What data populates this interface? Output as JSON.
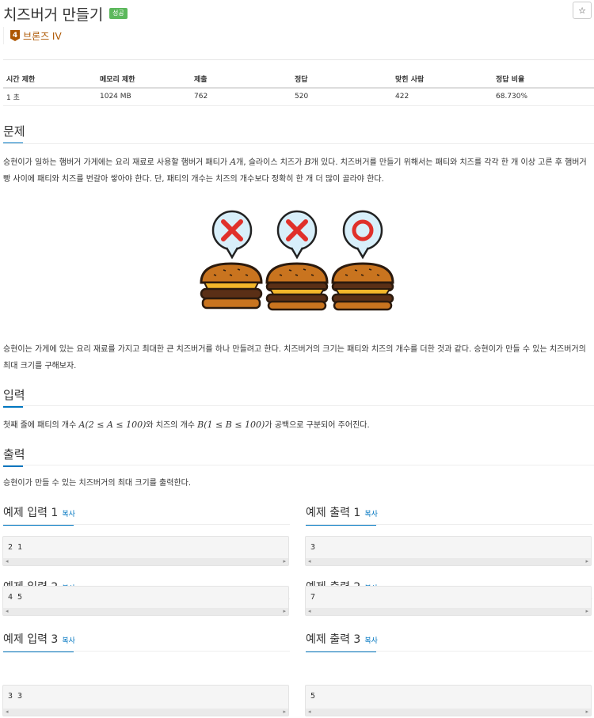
{
  "problem": {
    "title": "치즈버거 만들기",
    "result_badge": "성공",
    "star_icon": "☆",
    "tier": {
      "number": "4",
      "label": "브론즈 IV"
    }
  },
  "info_table": {
    "headers": [
      "시간 제한",
      "메모리 제한",
      "제출",
      "정답",
      "맞힌 사람",
      "정답 비율"
    ],
    "values": [
      "1 초",
      "1024 MB",
      "762",
      "520",
      "422",
      "68.730%"
    ]
  },
  "sections": {
    "problem_title": "문제",
    "problem_text_1a": "승현이가 일하는 햄버거 가게에는 요리 재료로 사용할 햄버거 패티가 ",
    "var_a": "A",
    "problem_text_1b": "개, 슬라이스 치즈가 ",
    "var_b": "B",
    "problem_text_1c": "개 있다. 치즈버거를 만들기 위해서는 패티와 치즈를 각각 한 개 이상 고른 후 햄버거 빵 사이에 패티와 치즈를 번갈아 쌓아야 한다. 단, 패티의 개수는 치즈의 개수보다 정확히 한 개 더 많이 골라야 한다.",
    "problem_text_2": "승현이는 가게에 있는 요리 재료를 가지고 최대한 큰 치즈버거를 하나 만들려고 한다. 치즈버거의 크기는 패티와 치즈의 개수를 더한 것과 같다. 승현이가 만들 수 있는 치즈버거의 최대 크기를 구해보자.",
    "input_title": "입력",
    "input_text_a": "첫째 줄에 패티의 개수 ",
    "input_math_a": "A(2 ≤ A ≤ 100)",
    "input_text_b": "와 치즈의 개수 ",
    "input_math_b": "B(1 ≤ B ≤ 100)",
    "input_text_c": "가 공백으로 구분되어 주어진다.",
    "output_title": "출력",
    "output_text": "승현이가 만들 수 있는 치즈버거의 최대 크기를 출력한다."
  },
  "examples": {
    "copy_label": "복사",
    "items": [
      {
        "in_title": "예제 입력 1",
        "in_value": "2 1",
        "out_title": "예제 출력 1",
        "out_value": "3"
      },
      {
        "in_title": "예제 입력 2",
        "in_value": "4 5",
        "out_title": "예제 출력 2",
        "out_value": "7"
      },
      {
        "in_title": "예제 입력 3",
        "in_value": "3 3",
        "out_title": "예제 출력 3",
        "out_value": "5"
      }
    ]
  },
  "colors": {
    "accent": "#0076c0",
    "success": "#5cb85c",
    "bronze": "#ad5600",
    "wrong": "#e0302a"
  },
  "illustration_marks": [
    "wrong-mark",
    "wrong-mark",
    "correct-mark"
  ]
}
